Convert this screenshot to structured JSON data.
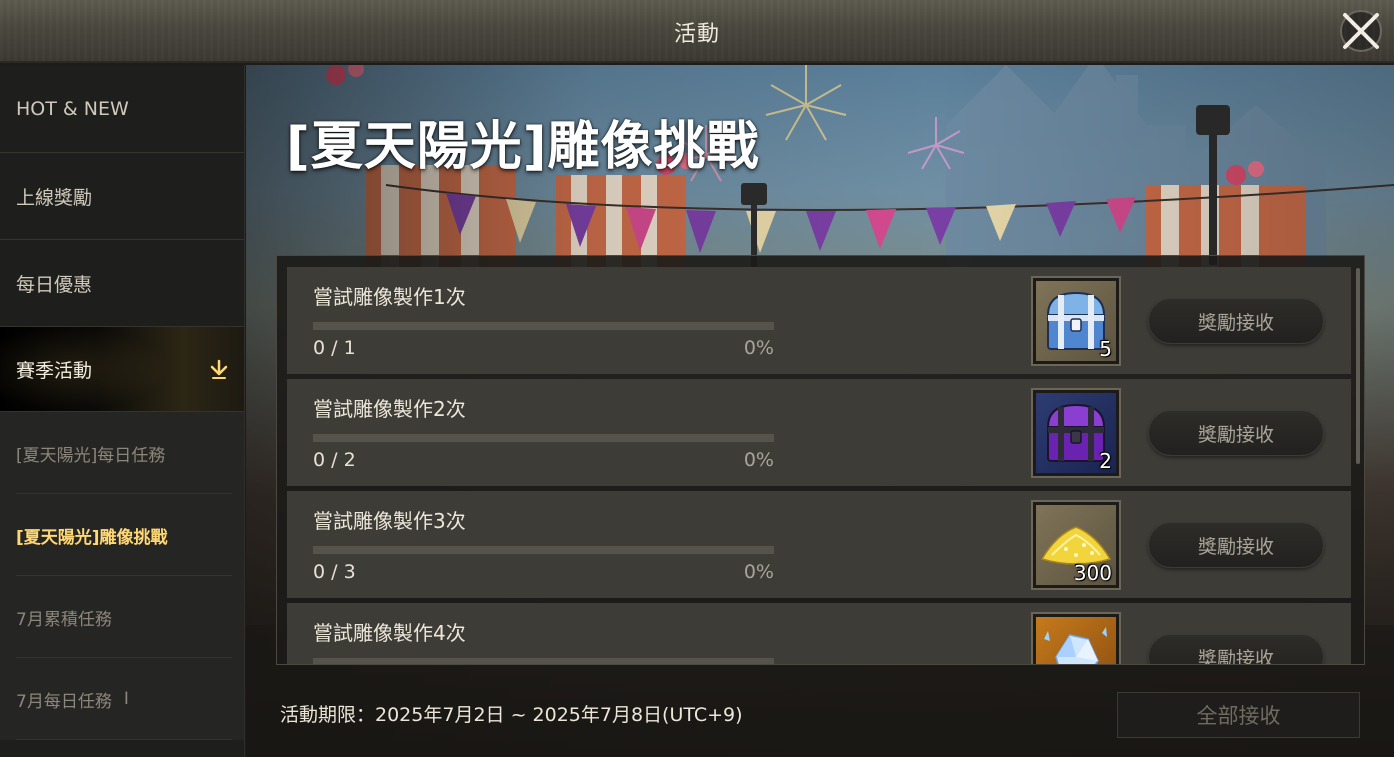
{
  "header": {
    "title": "活動",
    "close_icon": "close-icon"
  },
  "sidebar": {
    "main_items": [
      {
        "label": "HOT & NEW"
      },
      {
        "label": "上線獎勵"
      },
      {
        "label": "每日優惠"
      },
      {
        "label": "賽季活動",
        "active": true
      }
    ],
    "sub_items": [
      {
        "label": "[夏天陽光]每日任務"
      },
      {
        "label": "[夏天陽光]雕像挑戰",
        "active": true
      },
      {
        "label": "7月累積任務"
      },
      {
        "label": "7月每日任務",
        "mark": "I"
      }
    ]
  },
  "event": {
    "title": "[夏天陽光]雕像挑戰",
    "missions": [
      {
        "name": "嘗試雕像製作1次",
        "count": "0 / 1",
        "progress": "0%",
        "reward_icon": "blue-chest-icon",
        "reward_qty": "5",
        "button": "獎勵接收"
      },
      {
        "name": "嘗試雕像製作2次",
        "count": "0 / 2",
        "progress": "0%",
        "reward_icon": "purple-chest-icon",
        "reward_qty": "2",
        "button": "獎勵接收"
      },
      {
        "name": "嘗試雕像製作3次",
        "count": "0 / 3",
        "progress": "0%",
        "reward_icon": "gold-pile-icon",
        "reward_qty": "300",
        "button": "獎勵接收"
      },
      {
        "name": "嘗試雕像製作4次",
        "count": "",
        "progress": "",
        "reward_icon": "crystal-icon",
        "reward_qty": "",
        "button": "獎勵接收"
      }
    ],
    "period": "活動期限：2025年7月2日 ~ 2025年7月8日(UTC+9)",
    "claim_all": "全部接收"
  },
  "colors": {
    "accent": "#ffd873",
    "progress_track": "#55534c",
    "row_bg": "#3d3c37"
  }
}
